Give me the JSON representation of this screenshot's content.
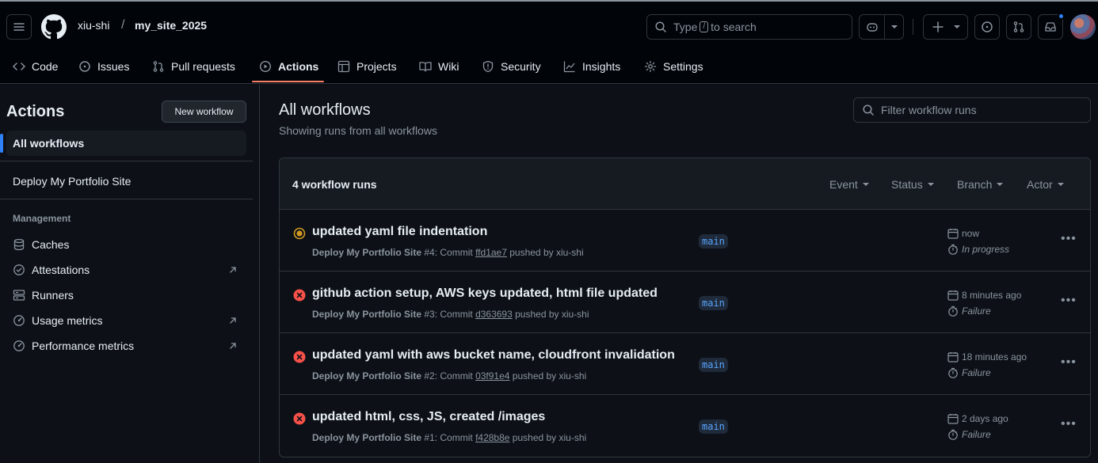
{
  "header": {
    "owner": "xiu-shi",
    "separator": "/",
    "repo": "my_site_2025",
    "search_placeholder_pre": "Type",
    "search_key": "/",
    "search_placeholder_post": "to search"
  },
  "tabs": [
    {
      "label": "Code",
      "icon": "code-icon"
    },
    {
      "label": "Issues",
      "icon": "issue-icon"
    },
    {
      "label": "Pull requests",
      "icon": "pull-request-icon"
    },
    {
      "label": "Actions",
      "icon": "play-icon",
      "active": true
    },
    {
      "label": "Projects",
      "icon": "table-icon"
    },
    {
      "label": "Wiki",
      "icon": "book-icon"
    },
    {
      "label": "Security",
      "icon": "shield-icon"
    },
    {
      "label": "Insights",
      "icon": "graph-icon"
    },
    {
      "label": "Settings",
      "icon": "gear-icon"
    }
  ],
  "sidebar": {
    "title": "Actions",
    "new_workflow": "New workflow",
    "all_workflows": "All workflows",
    "workflows": [
      "Deploy My Portfolio Site"
    ],
    "management_label": "Management",
    "management": [
      {
        "label": "Caches",
        "icon": "database-icon"
      },
      {
        "label": "Attestations",
        "icon": "verified-icon",
        "external": true
      },
      {
        "label": "Runners",
        "icon": "server-icon"
      },
      {
        "label": "Usage metrics",
        "icon": "meter-icon",
        "external": true
      },
      {
        "label": "Performance metrics",
        "icon": "meter-icon",
        "external": true
      }
    ]
  },
  "main": {
    "title": "All workflows",
    "subtitle": "Showing runs from all workflows",
    "filter_placeholder": "Filter workflow runs",
    "runs_count": "4 workflow runs",
    "filters": [
      "Event",
      "Status",
      "Branch",
      "Actor"
    ],
    "runs": [
      {
        "status": "in_progress",
        "title": "updated yaml file indentation",
        "workflow": "Deploy My Portfolio Site",
        "run": "#4",
        "commit_prefix": ": Commit",
        "sha": "ffd1ae7",
        "pushed_by": "pushed by xiu-shi",
        "branch": "main",
        "time": "now",
        "state": "In progress"
      },
      {
        "status": "failure",
        "title": "github action setup, AWS keys updated, html file updated",
        "workflow": "Deploy My Portfolio Site",
        "run": "#3",
        "commit_prefix": ": Commit",
        "sha": "d363693",
        "pushed_by": "pushed by xiu-shi",
        "branch": "main",
        "time": "8 minutes ago",
        "state": "Failure"
      },
      {
        "status": "failure",
        "title": "updated yaml with aws bucket name, cloudfront invalidation",
        "workflow": "Deploy My Portfolio Site",
        "run": "#2",
        "commit_prefix": ": Commit",
        "sha": "03f91e4",
        "pushed_by": "pushed by xiu-shi",
        "branch": "main",
        "time": "18 minutes ago",
        "state": "Failure"
      },
      {
        "status": "failure",
        "title": "updated html, css, JS, created /images",
        "workflow": "Deploy My Portfolio Site",
        "run": "#1",
        "commit_prefix": ": Commit",
        "sha": "f428b8e",
        "pushed_by": "pushed by xiu-shi",
        "branch": "main",
        "time": "2 days ago",
        "state": "Failure"
      }
    ]
  },
  "colors": {
    "accent_tab": "#f78166",
    "in_progress": "#d29922",
    "failure": "#f85149",
    "link": "#58a6ff",
    "notification_dot": "#2f81f7"
  }
}
